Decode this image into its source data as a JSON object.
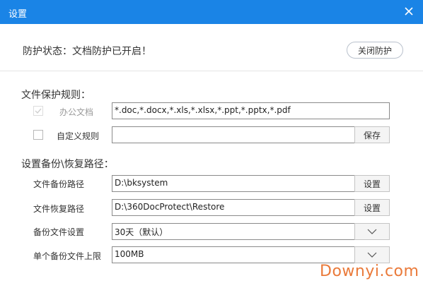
{
  "window": {
    "title": "设置",
    "close_icon": "close-icon"
  },
  "status": {
    "text": "防护状态：文档防护已开启！",
    "toggle_button": "关闭防护"
  },
  "protection_rules": {
    "heading": "文件保护规则：",
    "office_docs": {
      "label": "办公文档",
      "value": "*.doc,*.docx,*.xls,*.xlsx,*.ppt,*.pptx,*.pdf",
      "checked": true,
      "disabled": true
    },
    "custom_rule": {
      "label": "自定义规则",
      "value": "",
      "checked": false,
      "save_button": "保存"
    }
  },
  "backup_paths": {
    "heading": "设置备份\\恢复路径：",
    "backup_path": {
      "label": "文件备份路径",
      "value": "D:\\bksystem",
      "button": "设置"
    },
    "restore_path": {
      "label": "文件恢复路径",
      "value": "D:\\360DocProtect\\Restore",
      "button": "设置"
    },
    "backup_setting": {
      "label": "备份文件设置",
      "value": "30天（默认）"
    },
    "size_limit": {
      "label": "单个备份文件上限",
      "value": "100MB"
    }
  },
  "watermark": "Downyi.com",
  "colors": {
    "titlebar": "#1a84e6",
    "watermark": "#ea7a3a"
  }
}
